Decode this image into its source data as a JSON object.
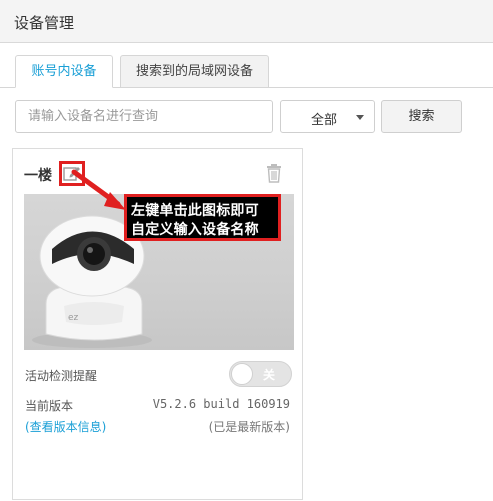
{
  "window": {
    "title": "设备管理"
  },
  "tabs": [
    {
      "label": "账号内设备",
      "active": true
    },
    {
      "label": "搜索到的局域网设备",
      "active": false
    }
  ],
  "search": {
    "placeholder": "请输入设备名进行查询",
    "value": "",
    "filter_selected": "全部",
    "button_label": "搜索"
  },
  "device": {
    "name": "一楼",
    "icons": [
      "edit-icon",
      "trash-icon"
    ],
    "annotation": {
      "line1": "左键单击此图标即可",
      "line2": "自定义输入设备名称"
    },
    "motion_alert": {
      "label": "活动检测提醒",
      "state_label": "关",
      "on": false
    },
    "version": {
      "label": "当前版本",
      "value": "V5.2.6 build 160919",
      "link_label": "(查看版本信息)",
      "status": "(已是最新版本)"
    }
  },
  "colors": {
    "accent": "#1a9fd6",
    "annotation_red": "#e02020"
  }
}
